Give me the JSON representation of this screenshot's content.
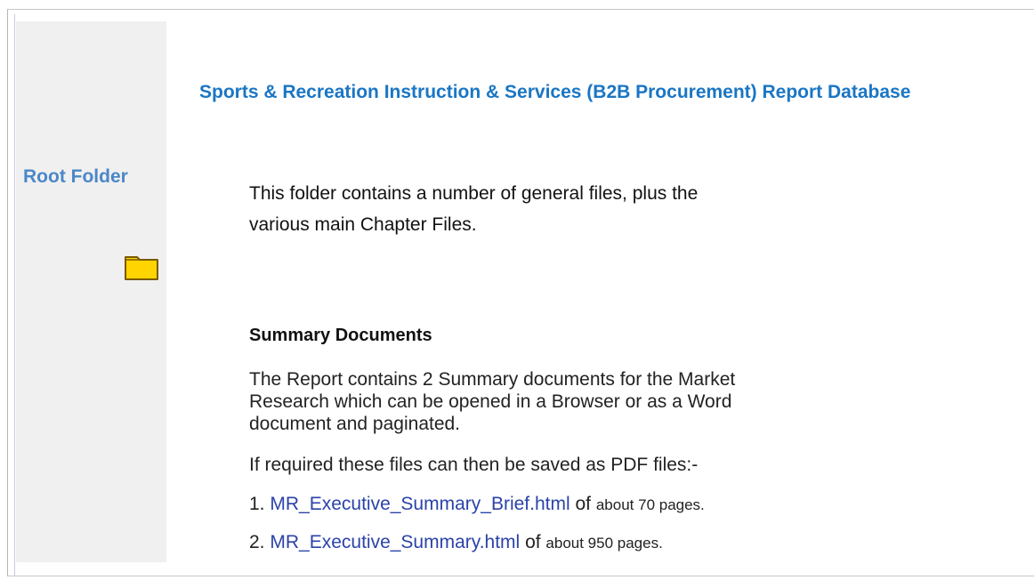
{
  "sidebar": {
    "root_label": "Root Folder",
    "folder_icon": "folder-icon",
    "folder_color": "#ffd400"
  },
  "main": {
    "title": "Sports & Recreation Instruction & Services (B2B Procurement) Report Database",
    "intro": "This folder contains a number of general files, plus the various main Chapter Files.",
    "summary_heading": "Summary Documents",
    "summary_text": "The Report contains 2 Summary documents for the Market Research which can be opened in a Browser or as a Word document and paginated.",
    "pdf_note": "If required these files can then be saved as PDF files:-",
    "documents": [
      {
        "number": "1.",
        "link_text": "MR_Executive_Summary_Brief.html",
        "of_text": "of",
        "pages_text": "about 70 pages."
      },
      {
        "number": "2.",
        "link_text": "MR_Executive_Summary.html",
        "of_text": "of",
        "pages_text": "about 950 pages."
      }
    ]
  },
  "colors": {
    "title_blue": "#1a76c4",
    "link_blue": "#2b43a8",
    "sidebar_label": "#4b87c8",
    "sidebar_bg": "#f0f0f0"
  }
}
